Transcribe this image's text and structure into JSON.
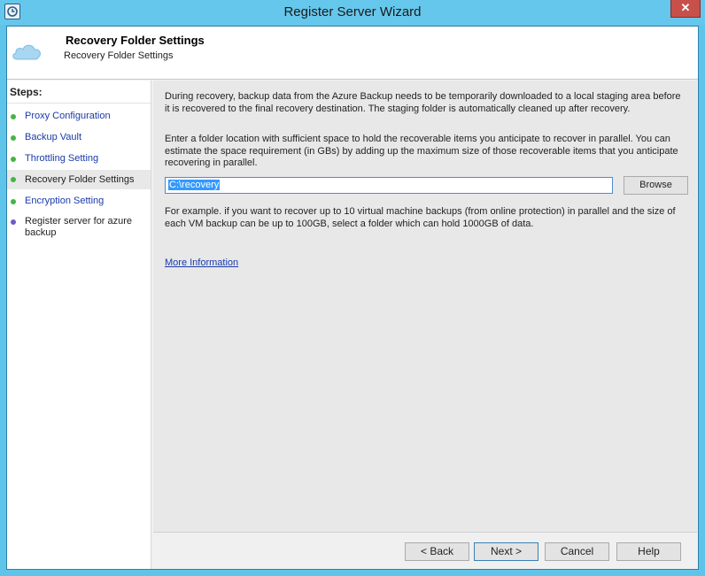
{
  "window": {
    "title": "Register Server Wizard",
    "close_glyph": "✕"
  },
  "header": {
    "title": "Recovery Folder Settings",
    "subtitle": "Recovery Folder Settings",
    "icon": "cloud-icon"
  },
  "sidebar": {
    "steps_label": "Steps:",
    "items": [
      {
        "label": "Proxy Configuration",
        "state": "completed"
      },
      {
        "label": "Backup Vault",
        "state": "completed"
      },
      {
        "label": "Throttling Setting",
        "state": "completed"
      },
      {
        "label": "Recovery Folder Settings",
        "state": "current"
      },
      {
        "label": "Encryption Setting",
        "state": "completed"
      },
      {
        "label": "Register server for azure backup",
        "state": "pending"
      }
    ]
  },
  "main": {
    "intro": "During recovery, backup data from the Azure Backup needs to be temporarily downloaded to a local staging area before it is recovered to the final recovery destination. The staging folder is automatically cleaned up after recovery.",
    "instruction": "Enter a folder location with sufficient space to hold the recoverable items you anticipate to recover in parallel. You can estimate the space requirement (in GBs) by adding up the maximum size of those recoverable items that you anticipate recovering in parallel.",
    "folder_value": "C:\\recovery",
    "browse_label": "Browse",
    "example": "For example. if you want to recover up to 10 virtual machine backups (from online protection) in parallel and the size of each VM backup can be up to 100GB, select a folder which can hold 1000GB of data.",
    "more_info": "More Information"
  },
  "footer": {
    "back_label": "< Back",
    "next_label": "Next >",
    "cancel_label": "Cancel",
    "help_label": "Help"
  },
  "colors": {
    "titlebar": "#66c7ec",
    "link": "#1a3aa8",
    "completed_dot": "#44b544",
    "pending_dot": "#6e5ac8"
  }
}
